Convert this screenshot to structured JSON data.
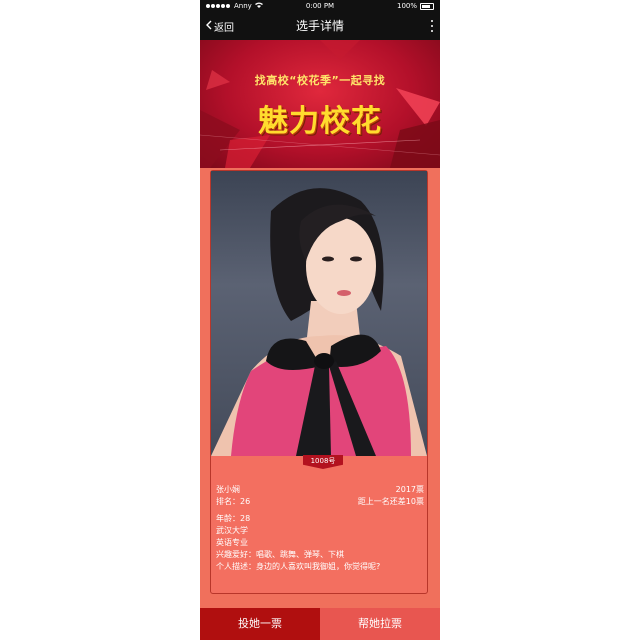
{
  "status_bar": {
    "carrier": "Anny",
    "time": "0:00 PM",
    "battery": "100%"
  },
  "nav": {
    "back_label": "返回",
    "title": "选手详情"
  },
  "banner": {
    "subtitle": "找高校“校花季”一起寻找",
    "title": "魅力校花"
  },
  "contestant": {
    "number_badge": "1008号",
    "name": "张小娴",
    "votes": "2017票",
    "rank": "排名：26",
    "gap_to_previous": "距上一名还差10票",
    "age": "年龄：28",
    "school": "武汉大学",
    "major": "英语专业",
    "hobbies": "兴趣爱好：唱歌、跳舞、弹琴、下棋",
    "description": "个人描述：身边的人喜欢叫我御姐，你觉得呢?"
  },
  "actions": {
    "vote_label": "投她一票",
    "help_label": "帮她拉票"
  },
  "colors": {
    "page_bg": "#f0705c",
    "banner_red": "#b3102a",
    "title_yellow": "#ffdc2e",
    "vote_button": "#b00f0f",
    "help_button": "#e85650"
  }
}
